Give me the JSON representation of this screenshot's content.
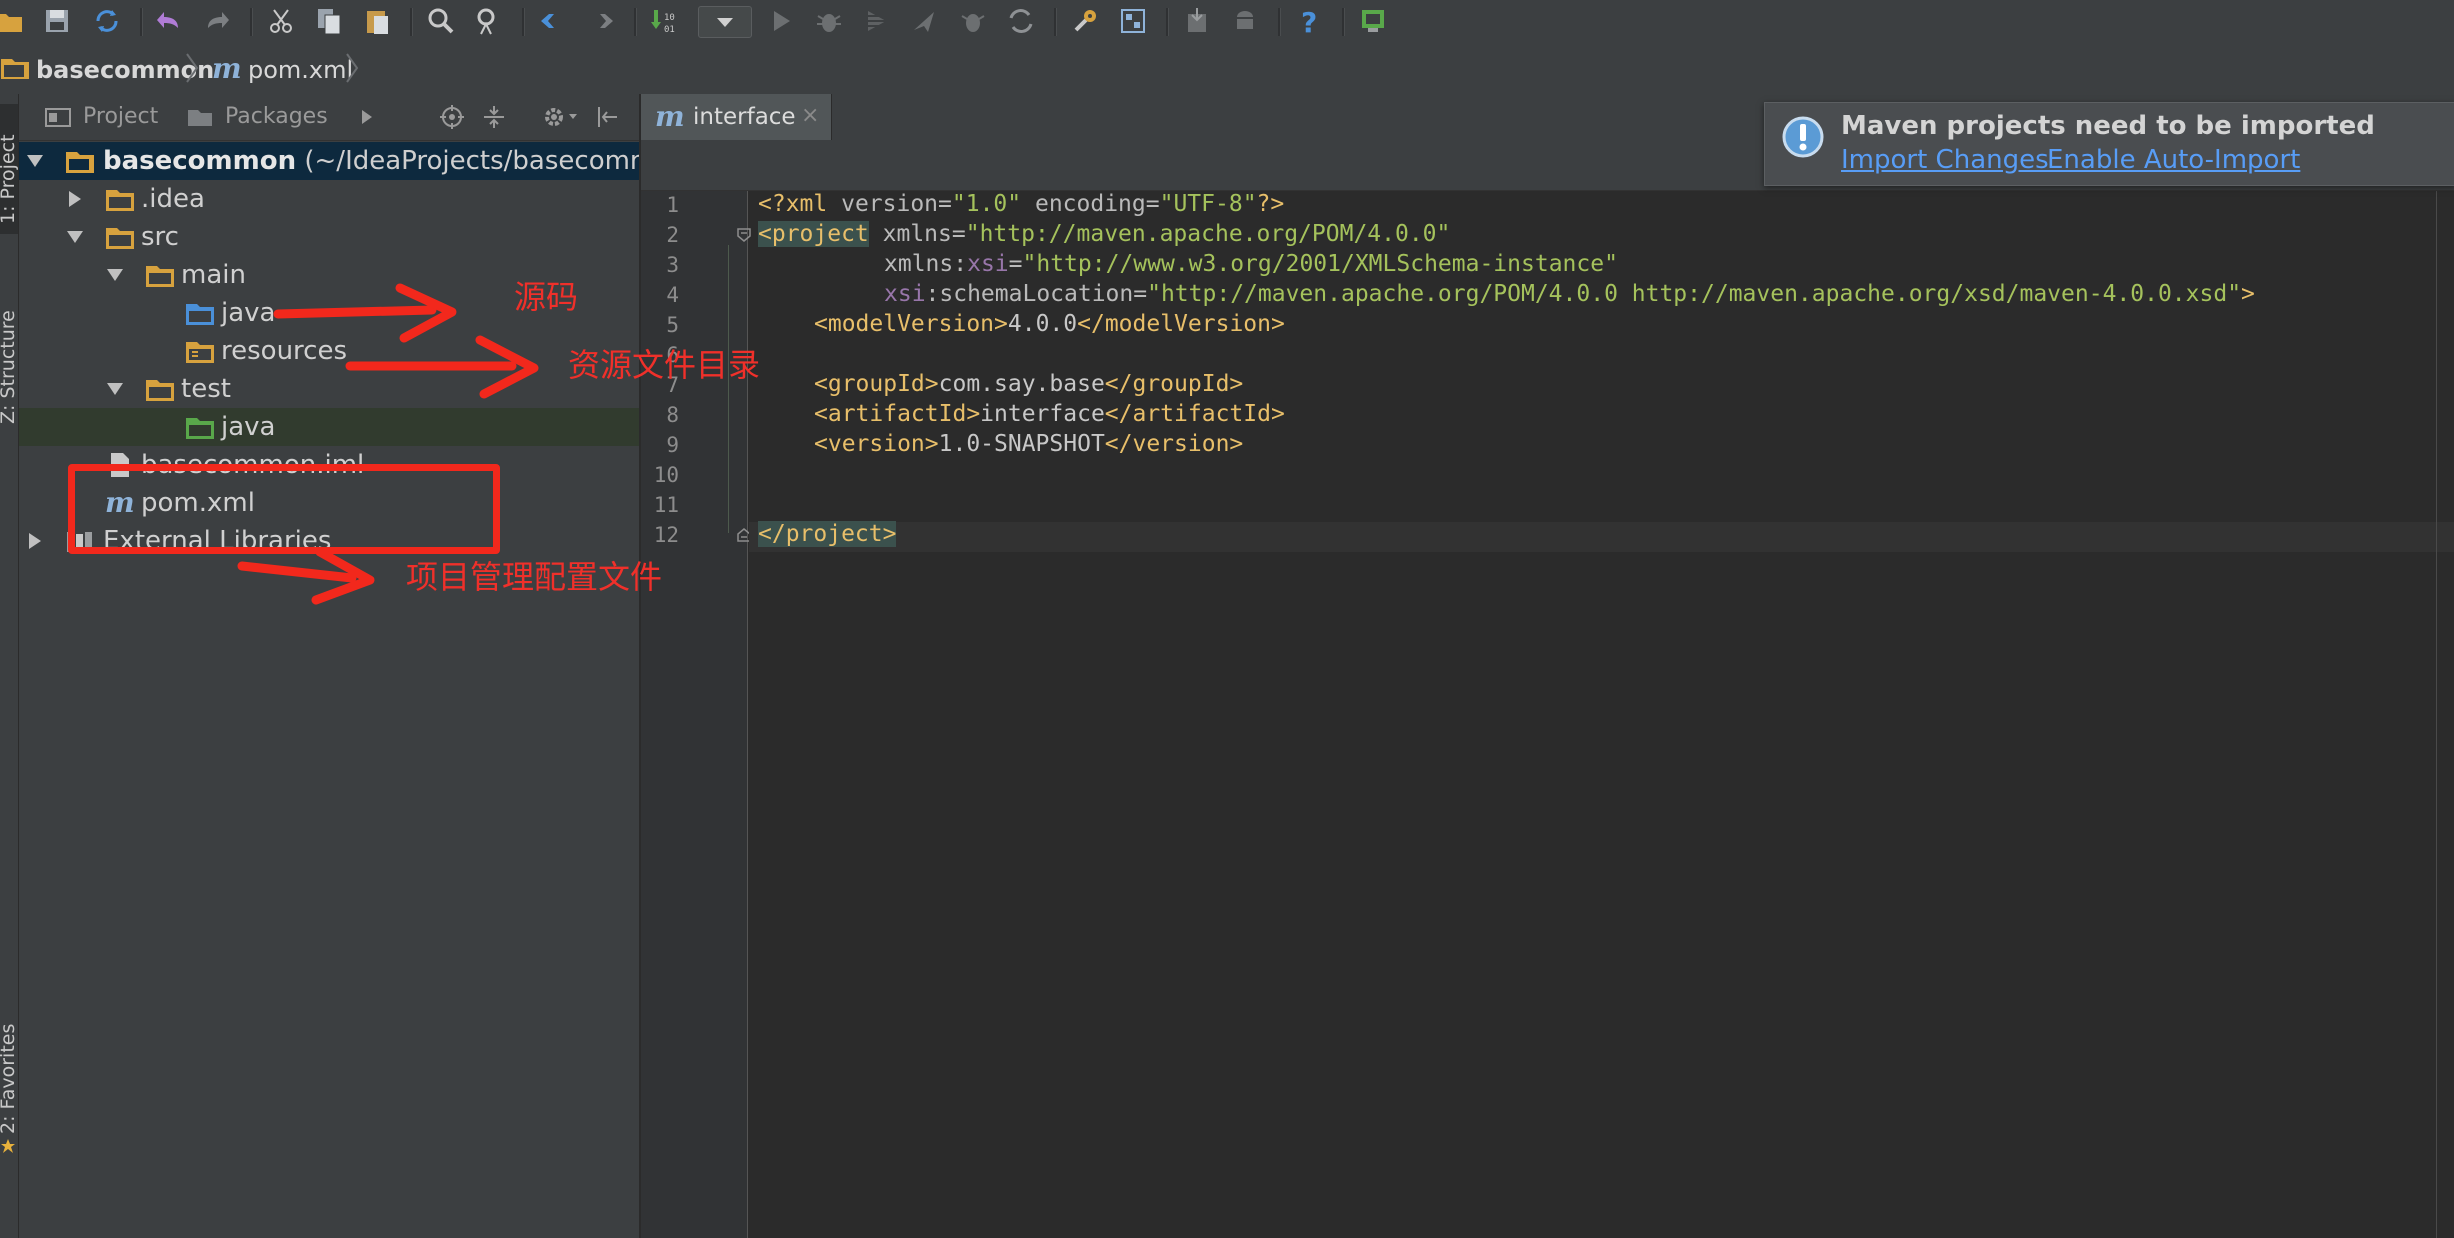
{
  "breadcrumb": {
    "project": "basecommon",
    "file_icon": "m",
    "file": "pom.xml"
  },
  "left_stripe": {
    "project_tab": "1: Project",
    "structure_tab": "Z: Structure",
    "favorites_tab": "2: Favorites"
  },
  "panel": {
    "project_tab": "Project",
    "packages_tab": "Packages"
  },
  "tree": {
    "root_name": "basecommon",
    "root_path": " (~/IdeaProjects/basecommo",
    "idea": ".idea",
    "src": "src",
    "main": "main",
    "main_java": "java",
    "resources": "resources",
    "test": "test",
    "test_java": "java",
    "iml": "basecommon.iml",
    "pom": "pom.xml",
    "external": "External Libraries"
  },
  "editor": {
    "tab_icon": "m",
    "tab_label": "interface",
    "tab_close": "×",
    "line_numbers": [
      "1",
      "2",
      "3",
      "4",
      "5",
      "6",
      "7",
      "8",
      "9",
      "10",
      "11",
      "12"
    ],
    "code": {
      "l1_open": "<?xml",
      "l1_a1": " version=",
      "l1_v1": "\"1.0\"",
      "l1_a2": " encoding=",
      "l1_v2": "\"UTF-8\"",
      "l1_close": "?>",
      "l2_tag": "<project",
      "l2_attr": " xmlns=",
      "l2_val": "\"http://maven.apache.org/POM/4.0.0\"",
      "l3_attr": "xmlns:",
      "l3_ns": "xsi",
      "l3_eq": "=",
      "l3_val": "\"http://www.w3.org/2001/XMLSchema-instance\"",
      "l4_ns": "xsi",
      "l4_attr": ":schemaLocation=",
      "l4_val": "\"http://maven.apache.org/POM/4.0.0 http://maven.apache.org/xsd/maven-4.0.0.xsd\"",
      "l4_close": ">",
      "l5_open": "<modelVersion>",
      "l5_text": "4.0.0",
      "l5_close": "</modelVersion>",
      "l7_open": "<groupId>",
      "l7_text": "com.say.base",
      "l7_close": "</groupId>",
      "l8_open": "<artifactId>",
      "l8_text": "interface",
      "l8_close": "</artifactId>",
      "l9_open": "<version>",
      "l9_text": "1.0-SNAPSHOT",
      "l9_close": "</version>",
      "l12_tag": "</project>"
    }
  },
  "notification": {
    "title": "Maven projects need to be imported",
    "import_changes": "Import Changes",
    "enable_auto_import": "Enable Auto-Import"
  },
  "annotations": {
    "source": "源码",
    "resources_dir": "资源文件目录",
    "pom_config": "项目管理配置文件"
  },
  "colors": {
    "annotation_red": "#f2281c",
    "link_blue": "#589df6",
    "xml_tag": "#e8bf6a",
    "xml_value": "#a5c25c"
  }
}
